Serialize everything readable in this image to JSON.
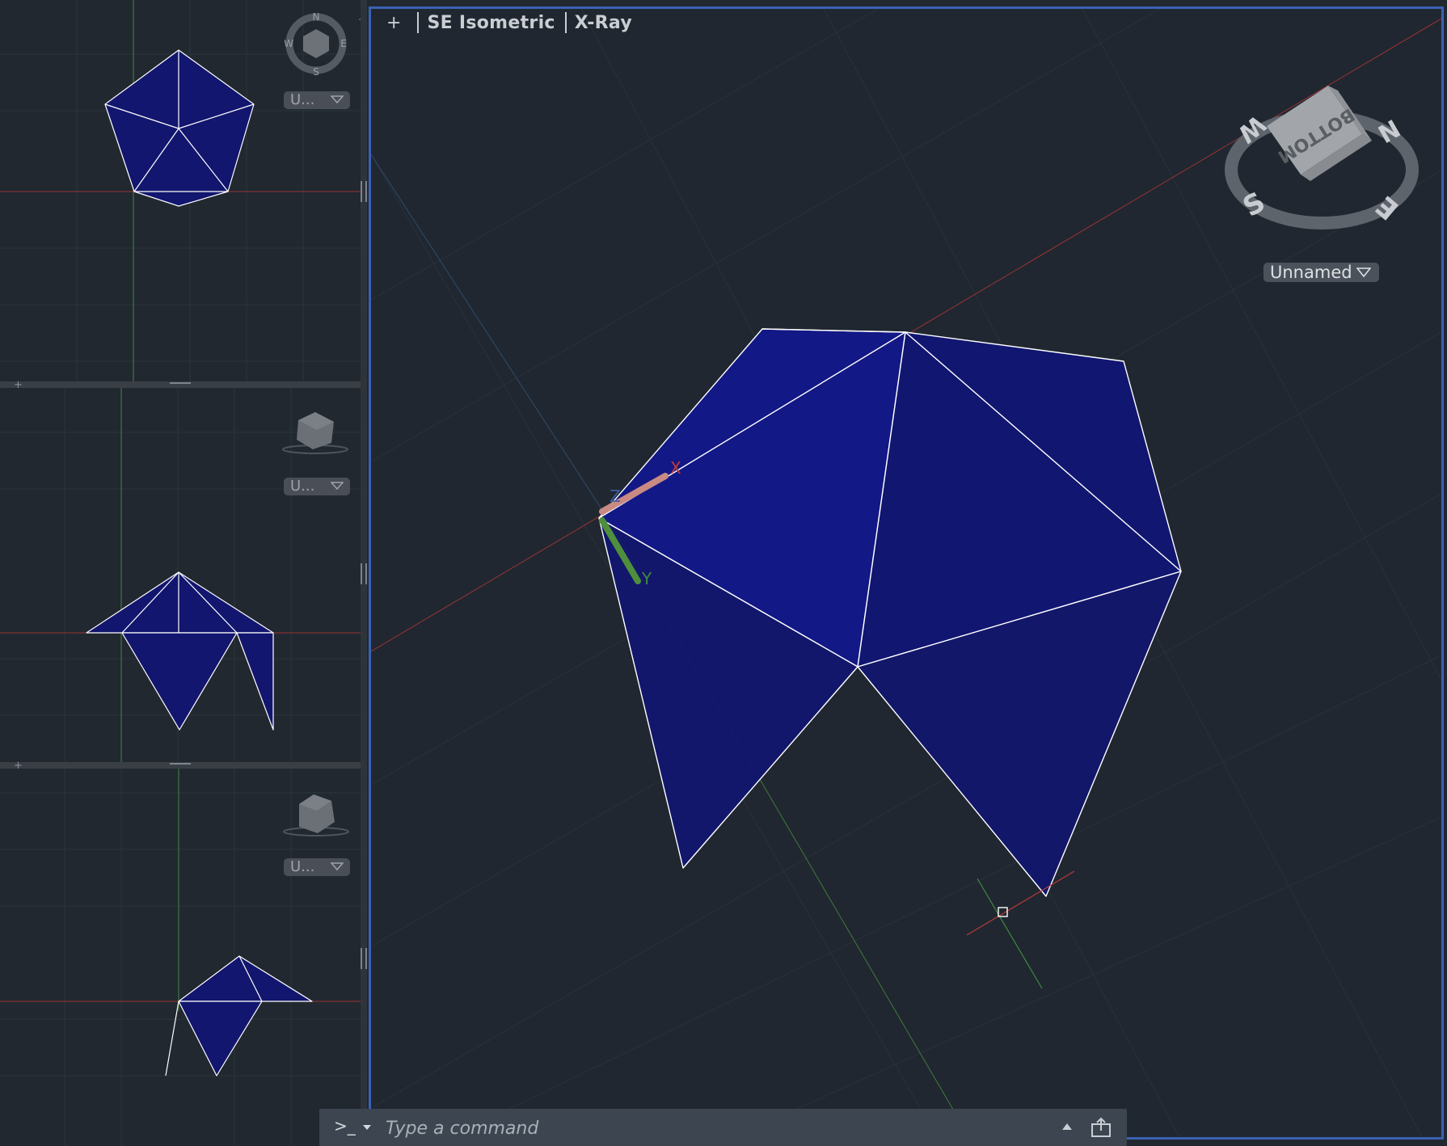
{
  "main_viewport": {
    "controls_label": "+",
    "view_label": "SE Isometric",
    "visual_style_label": "X-Ray",
    "viewcube_face": "BOTTOM",
    "compass": {
      "north": "N",
      "south": "S",
      "east": "E",
      "west": "W"
    },
    "ucs_dropdown": "Unnamed"
  },
  "side_viewports": [
    {
      "name": "top-viewport",
      "ucs_dropdown": "U...",
      "compass": {
        "north": "N",
        "south": "S",
        "east": "E",
        "west": "W"
      }
    },
    {
      "name": "front-viewport",
      "ucs_dropdown": "U..."
    },
    {
      "name": "right-viewport",
      "ucs_dropdown": "U..."
    }
  ],
  "ucs_axes": {
    "x": "X",
    "y": "Y",
    "z": "Z"
  },
  "command_line": {
    "prompt_icon": ">_",
    "placeholder": "Type a command"
  },
  "colors": {
    "background": "#212830",
    "face_fill": "#12166e",
    "edge": "#ffffff",
    "x_axis": "#b83a3a",
    "y_axis": "#3f8a3f",
    "active_border": "#3a62b4"
  },
  "icons": [
    "plus-icon",
    "viewcube-icon",
    "compass-icon",
    "ucs-icon",
    "crosshair-cursor-icon",
    "chevron-down-icon",
    "chevron-up-icon",
    "share-icon"
  ]
}
